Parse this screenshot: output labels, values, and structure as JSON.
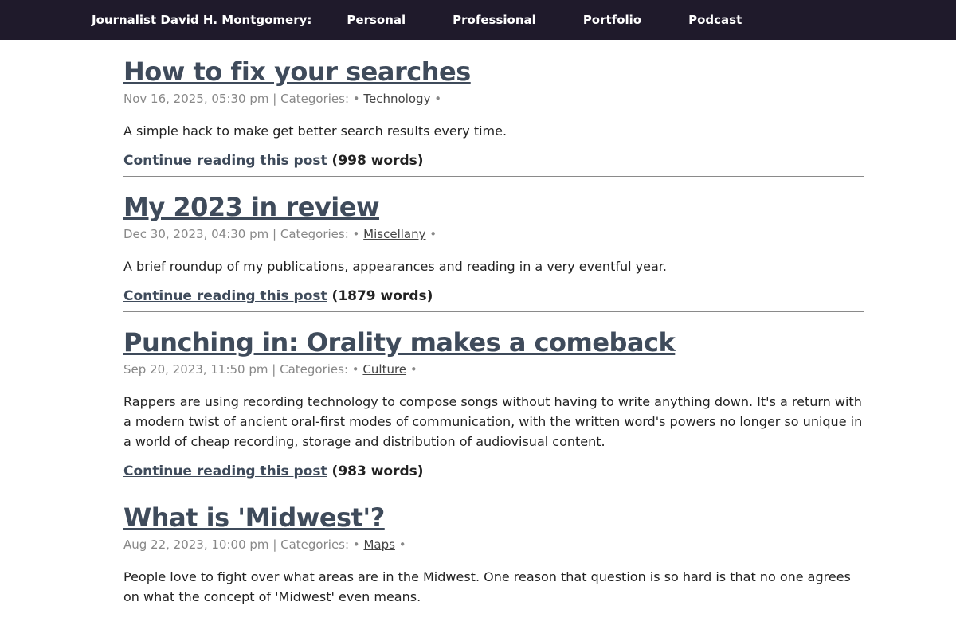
{
  "nav": {
    "site_title": "Journalist David H. Montgomery:",
    "links": [
      "Personal",
      "Professional",
      "Portfolio",
      "Podcast"
    ]
  },
  "posts": [
    {
      "title": "How to fix your searches",
      "date": "Nov 16, 2025, 05:30 pm",
      "categories_label": "| Categories: •",
      "category": "Technology",
      "separator": "•",
      "excerpt": "A simple hack to make get better search results every time.",
      "continue_label": "Continue reading this post",
      "word_count": "(998 words)"
    },
    {
      "title": "My 2023 in review",
      "date": "Dec 30, 2023, 04:30 pm",
      "categories_label": "| Categories: •",
      "category": "Miscellany",
      "separator": "•",
      "excerpt": "A brief roundup of my publications, appearances and reading in a very eventful year.",
      "continue_label": "Continue reading this post",
      "word_count": "(1879 words)"
    },
    {
      "title": "Punching in: Orality makes a comeback",
      "date": "Sep 20, 2023, 11:50 pm",
      "categories_label": "| Categories: •",
      "category": "Culture",
      "separator": "•",
      "excerpt": "Rappers are using recording technology to compose songs without having to write anything down. It's a return with a modern twist of ancient oral-first modes of communication, with the written word's powers no longer so unique in a world of cheap recording, storage and distribution of audiovisual content.",
      "continue_label": "Continue reading this post",
      "word_count": "(983 words)"
    },
    {
      "title": "What is 'Midwest'?",
      "date": "Aug 22, 2023, 10:00 pm",
      "categories_label": "| Categories: •",
      "category": "Maps",
      "separator": "•",
      "excerpt": "People love to fight over what areas are in the Midwest. One reason that question is so hard is that no one agrees on what the concept of 'Midwest' even means.",
      "continue_label": "",
      "word_count": ""
    }
  ]
}
